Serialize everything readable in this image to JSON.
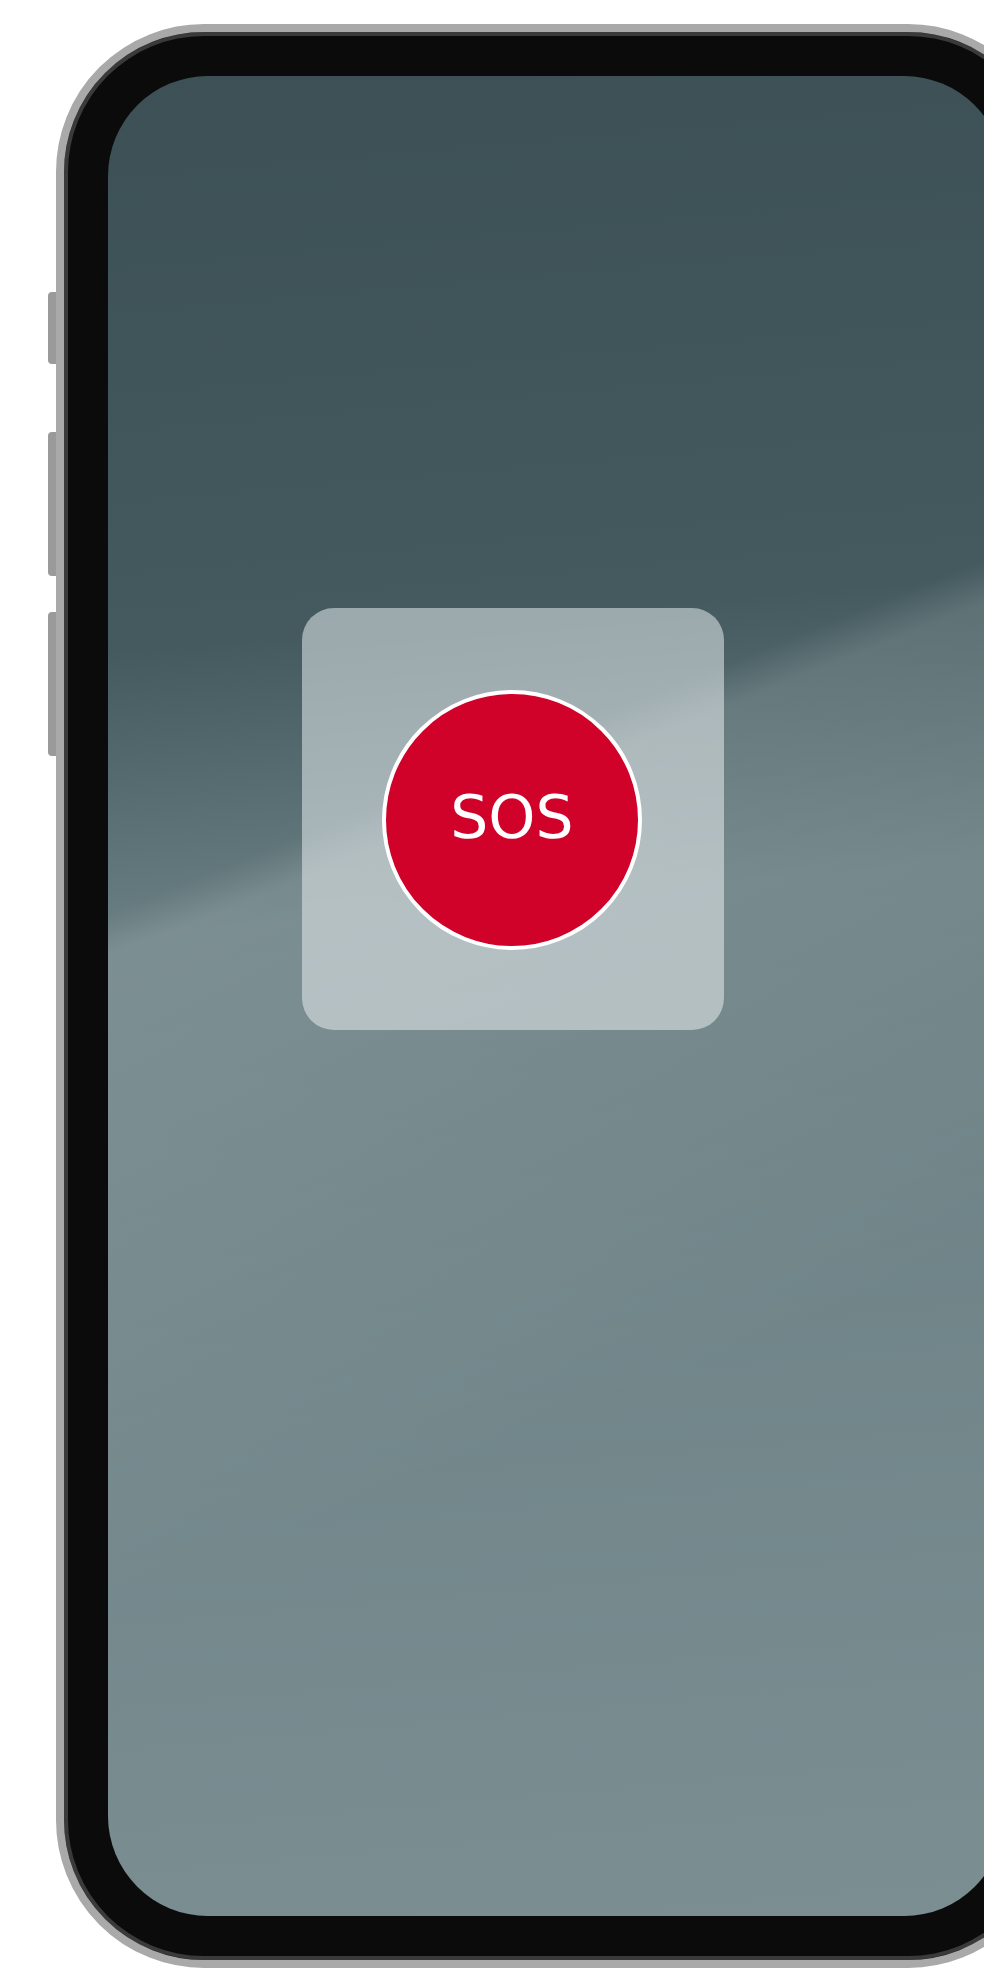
{
  "sos_button": {
    "label": "SOS"
  }
}
